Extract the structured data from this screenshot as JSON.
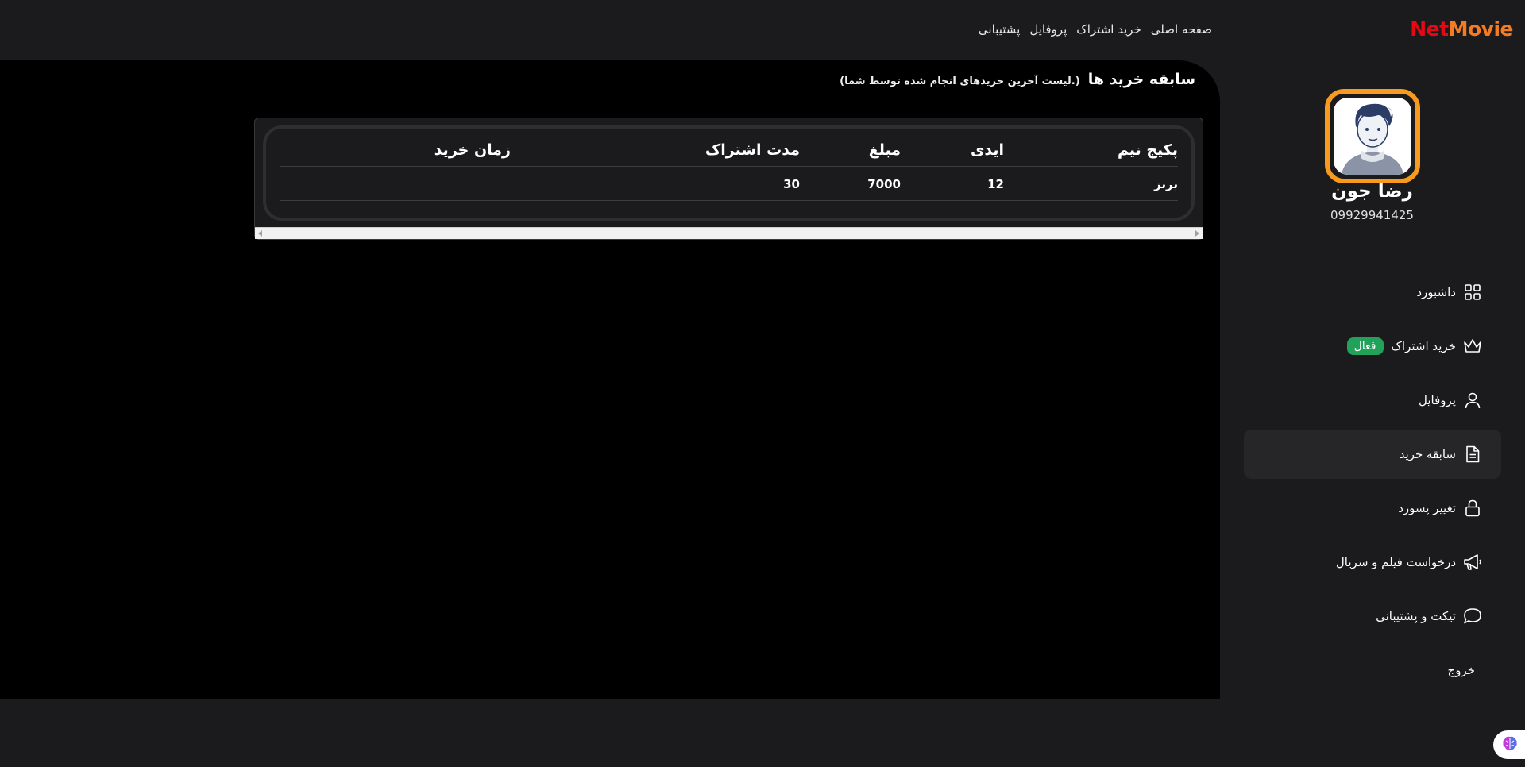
{
  "logo": {
    "part1": "Net",
    "part2": "Movie"
  },
  "topnav": {
    "home": "صفحه اصلی",
    "buy": "خرید اشتراک",
    "profile": "پروفایل",
    "support": "پشتیبانی"
  },
  "page": {
    "title": "سابقه خرید ها",
    "subtitle": "(لیست آخرین خریدهای انجام شده توسط شما.)"
  },
  "table": {
    "headers": {
      "package": "پکیج نیم",
      "id": "ایدی",
      "amount": "مبلغ",
      "duration": "مدت اشتراک",
      "time": "زمان خرید"
    },
    "rows": [
      {
        "package": "برنز",
        "id": "12",
        "amount": "7000",
        "duration": "30",
        "time": ""
      }
    ]
  },
  "user": {
    "name": "رضا جون",
    "phone": "09929941425"
  },
  "sidebar": {
    "dashboard": "داشبورد",
    "subscription": "خرید اشتراک",
    "subscription_badge": "فعال",
    "profile": "پروفایل",
    "history": "سابقه خرید",
    "password": "تغییر پسورد",
    "request": "درخواست فیلم و سریال",
    "ticket": "تیکت و پشتیبانی",
    "logout": "خروج"
  },
  "colors": {
    "brand_red": "#e50914",
    "brand_orange": "#f47b20",
    "badge_green": "#22a15a",
    "avatar_ring": "#f79a1e"
  }
}
